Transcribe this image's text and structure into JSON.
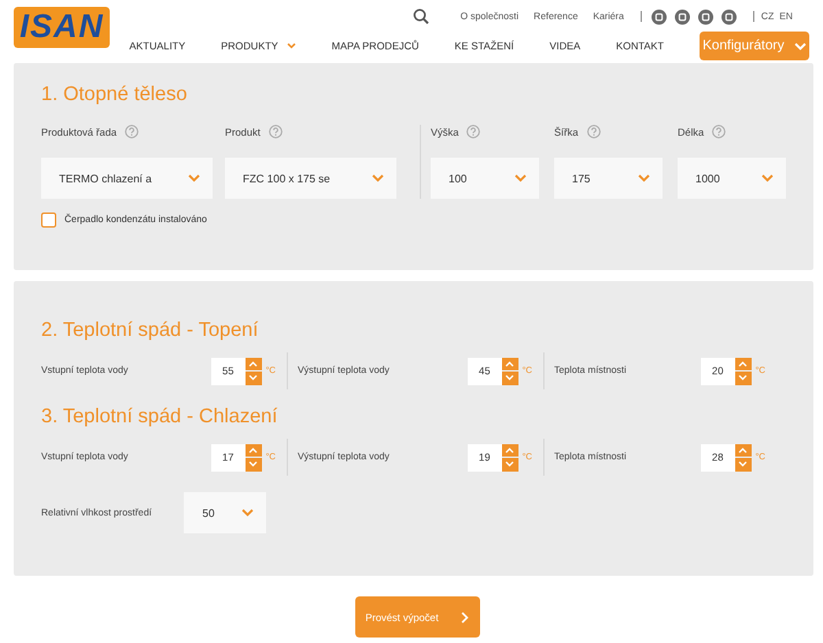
{
  "header": {
    "logo": "ISAN",
    "top_links": [
      "O společnosti",
      "Reference",
      "Kariéra"
    ],
    "languages": [
      "CZ",
      "EN"
    ],
    "nav": [
      {
        "label": "AKTUALITY",
        "has_dropdown": false
      },
      {
        "label": "PRODUKTY",
        "has_dropdown": true
      },
      {
        "label": "MAPA PRODEJCŮ",
        "has_dropdown": false
      },
      {
        "label": "KE STAŽENÍ",
        "has_dropdown": false
      },
      {
        "label": "VIDEA",
        "has_dropdown": false
      },
      {
        "label": "KONTAKT",
        "has_dropdown": false
      }
    ],
    "configurator_button": "Konfigurátory"
  },
  "radiator": {
    "title": "1. Otopné těleso",
    "fields": [
      {
        "label": "Produktová řada",
        "value": "TERMO chlazení a"
      },
      {
        "label": "Produkt",
        "value": "FZC 100 x 175 se"
      },
      {
        "label": "Výška",
        "value": "100"
      },
      {
        "label": "Šířka",
        "value": "175"
      },
      {
        "label": "Délka",
        "value": "1000"
      }
    ],
    "checkbox": {
      "label": "Čerpadlo kondenzátu instalováno",
      "checked": false
    }
  },
  "heating": {
    "title": "2. Teplotní spád - Topení",
    "rows": [
      {
        "label": "Vstupní teplota vody",
        "value": "55",
        "unit": "°C"
      },
      {
        "label": "Výstupní teplota vody",
        "value": "45",
        "unit": "°C"
      },
      {
        "label": "Teplota místnosti",
        "value": "20",
        "unit": "°C"
      }
    ]
  },
  "cooling": {
    "title": "3. Teplotní spád - Chlazení",
    "rows": [
      {
        "label": "Vstupní teplota vody",
        "value": "17",
        "unit": "°C"
      },
      {
        "label": "Výstupní teplota vody",
        "value": "19",
        "unit": "°C"
      },
      {
        "label": "Teplota místnosti",
        "value": "28",
        "unit": "°C"
      }
    ],
    "humidity": {
      "label": "Relativní vlhkost prostředí",
      "value": "50"
    }
  },
  "submit_button": "Provést výpočet"
}
